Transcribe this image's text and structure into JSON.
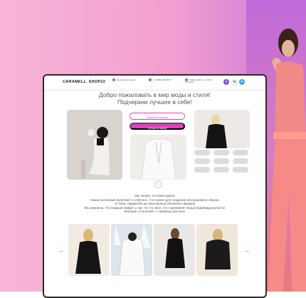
{
  "header": {
    "brand": "CARAMELL_SHOP22",
    "item1": "Наш шоурум здесь",
    "item2": "+7 (999) 123-45-67",
    "item3": "Режим работы с 10:00 до 20:00"
  },
  "hero": {
    "title_line1": "Добро пожаловать в мир моды и стиля!",
    "title_line2": "Подчеркни лучшее в себе!",
    "btn_outline": "Перейти в каталог",
    "btn_filled": "Оставить заявку"
  },
  "about": {
    "line1": "Мы знаем, что Вам нужно!",
    "line2": "Наша коллекция включает в себя все, что нужно для создания неотразимого образа",
    "line3": "от базы гардероба до изысканных вечерних нарядов",
    "line4": "Мы уверены, что каждый найдет у нас что-то свое, что подчеркнет Вашу индивидуальность!",
    "line5": "Магазин «Caramell» с любовью для вас!"
  },
  "colors": {
    "accent": "#e53cc3",
    "bg_pink": "#f7b6d8",
    "bg_purple": "#c77ad8"
  },
  "icons": [
    "location-icon",
    "phone-icon",
    "clock-icon",
    "viber-icon",
    "whatsapp-icon",
    "telegram-icon",
    "arrow-down-icon",
    "arrow-left-icon",
    "arrow-right-icon"
  ]
}
